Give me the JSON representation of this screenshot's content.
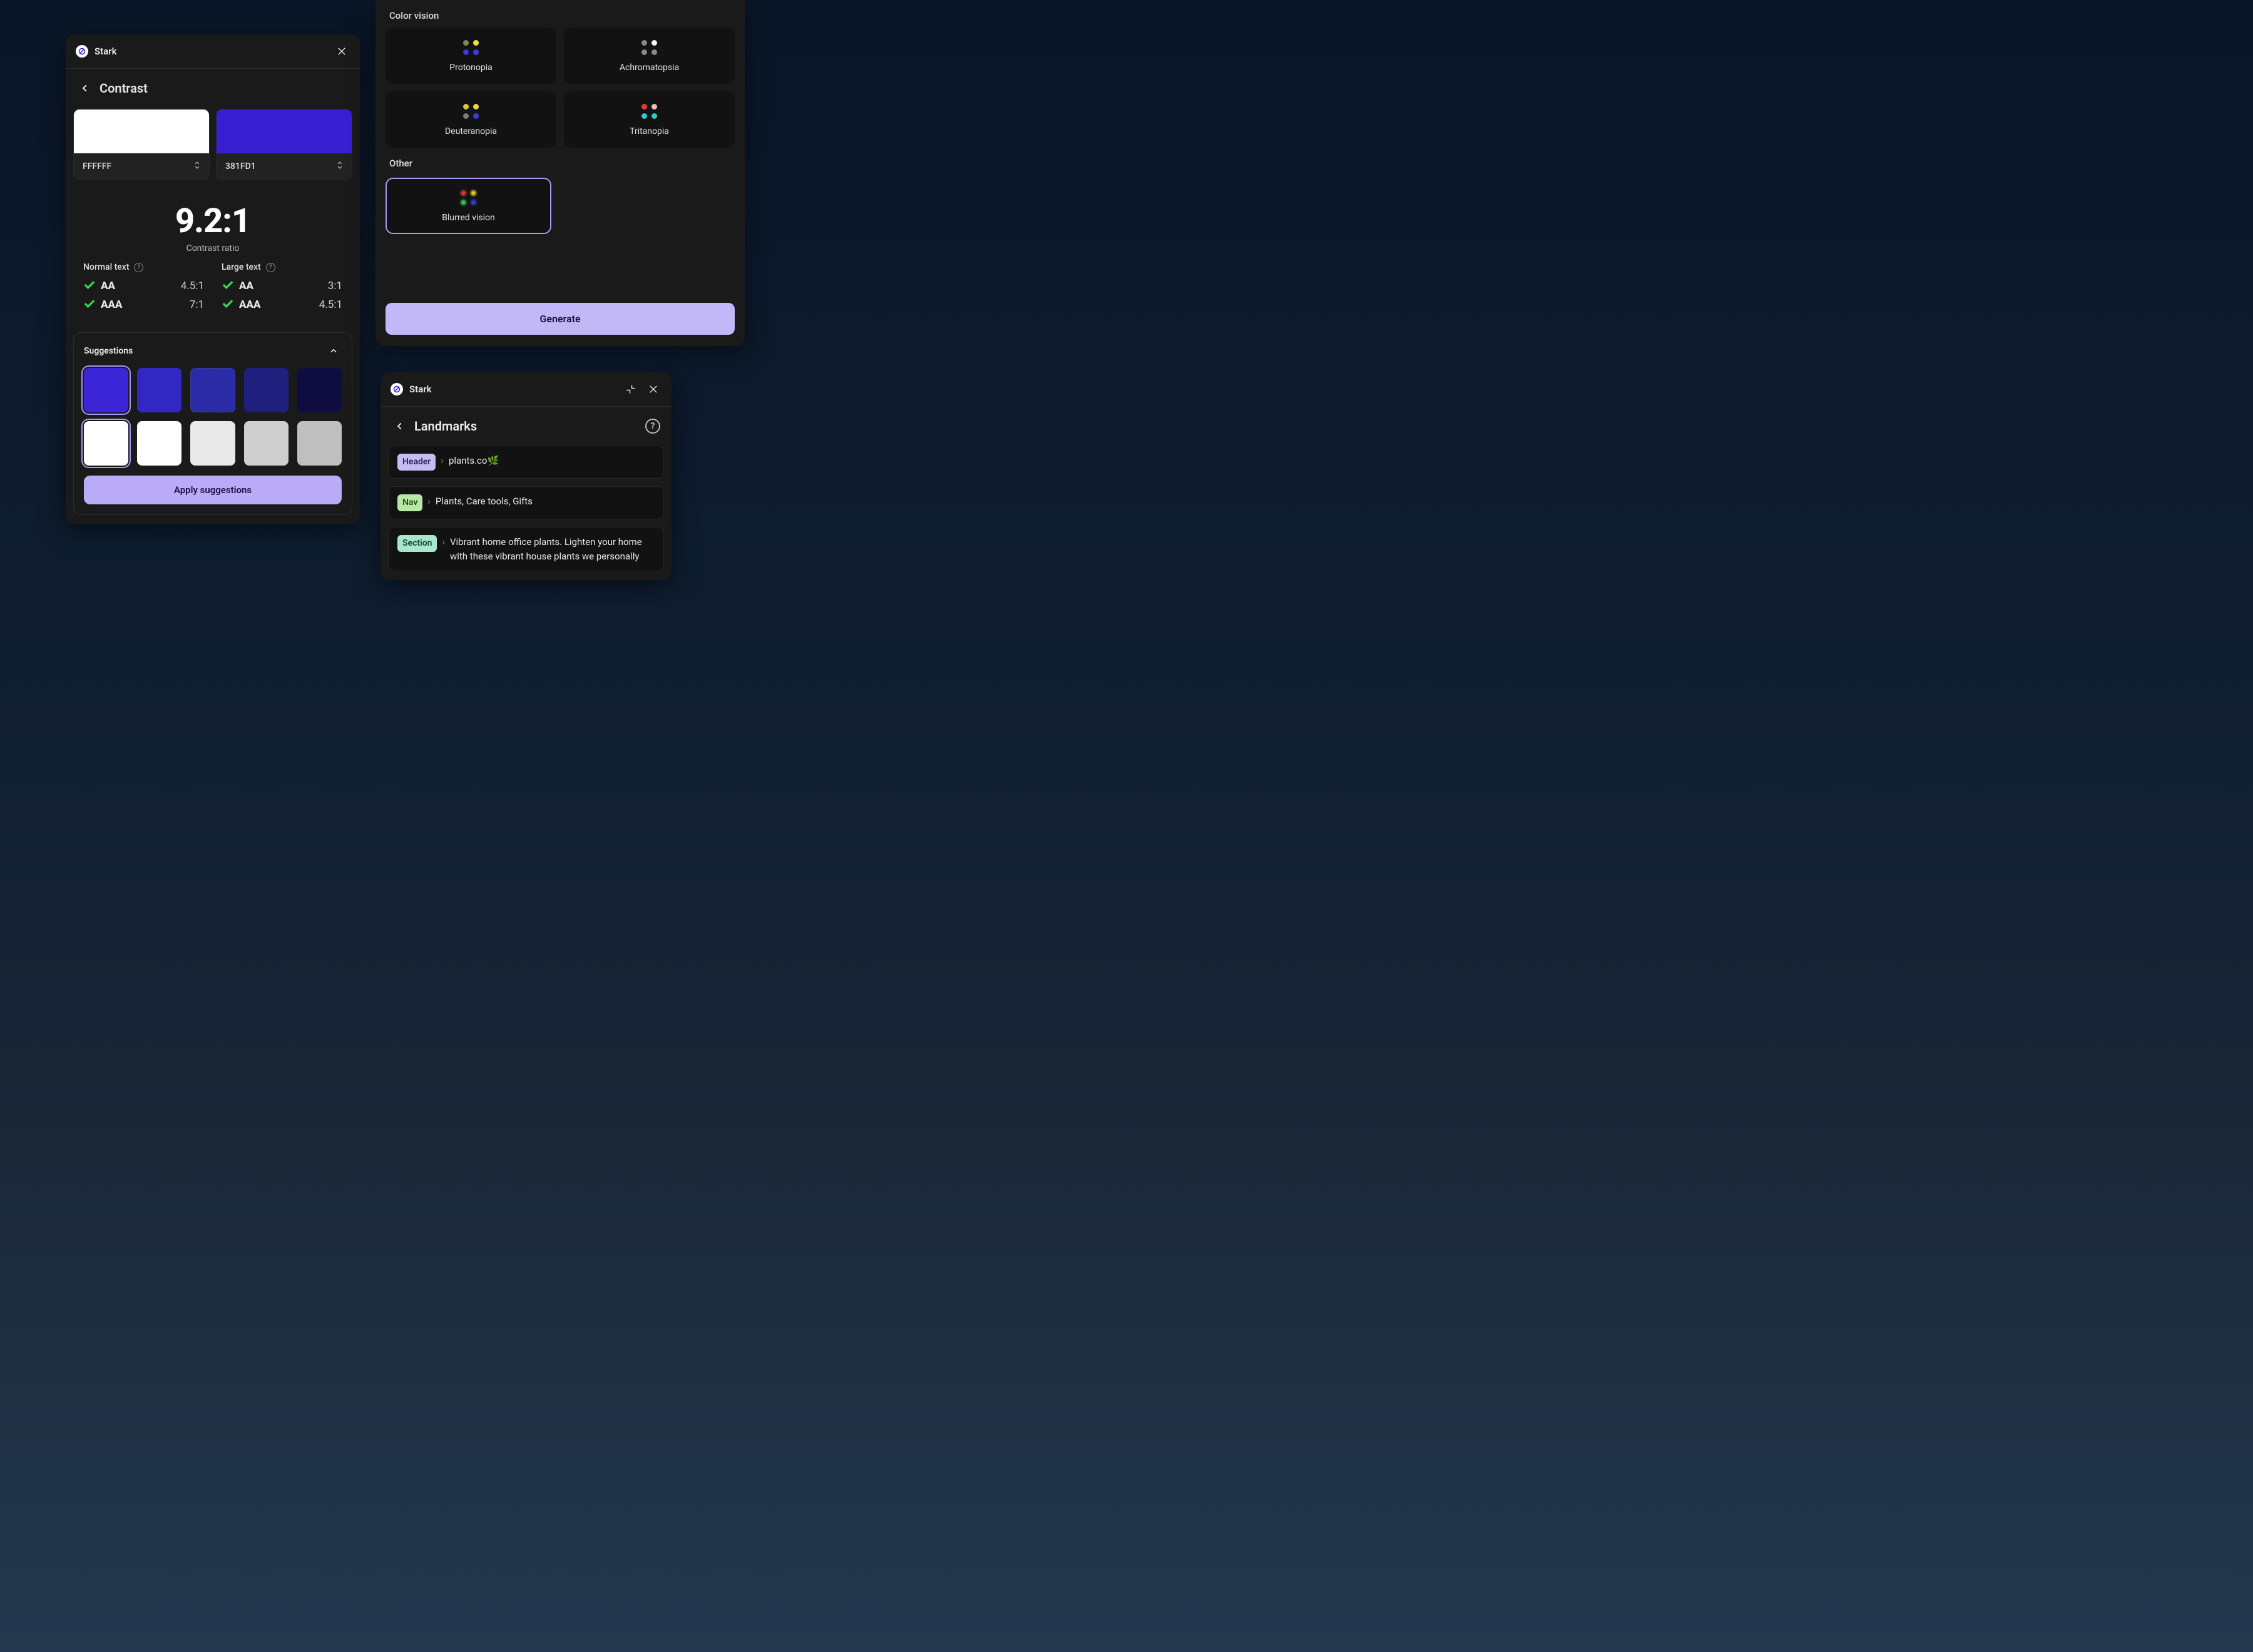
{
  "app_name": "Stark",
  "contrast": {
    "title": "Contrast",
    "fg_hex": "FFFFFF",
    "bg_hex": "381FD1",
    "fg_color": "#FFFFFF",
    "bg_color": "#381FD1",
    "ratio": "9.2:1",
    "ratio_label": "Contrast ratio",
    "normal_label": "Normal text",
    "large_label": "Large text",
    "normal_aa_level": "AA",
    "normal_aa_req": "4.5:1",
    "normal_aaa_level": "AAA",
    "normal_aaa_req": "7:1",
    "large_aa_level": "AA",
    "large_aa_req": "3:1",
    "large_aaa_level": "AAA",
    "large_aaa_req": "4.5:1",
    "suggestions_label": "Suggestions",
    "apply_label": "Apply suggestions",
    "sugg_row1": [
      "#3b25d6",
      "#3227c2",
      "#2c2ba7",
      "#1f1f7d",
      "#0f0c3f"
    ],
    "sugg_row2": [
      "#ffffff",
      "#ffffff",
      "#e9e9e9",
      "#cfcfcf",
      "#bfbfbf"
    ]
  },
  "vision": {
    "color_vision_label": "Color vision",
    "other_label": "Other",
    "generate_label": "Generate",
    "cards": {
      "protonopia": "Protonopia",
      "achromatopsia": "Achromatopsia",
      "deuteranopia": "Deuteranopia",
      "tritanopia": "Tritanopia",
      "blurred": "Blurred vision"
    },
    "dot_palettes": {
      "protonopia": [
        "#858555",
        "#f2e233",
        "#3b3be0",
        "#3b3be0"
      ],
      "achromatopsia": [
        "#8a8a8a",
        "#f2f2f2",
        "#8a8a8a",
        "#8a8a8a"
      ],
      "deuteranopia": [
        "#d8c933",
        "#e8d833",
        "#7a7a7a",
        "#3b3be0"
      ],
      "tritanopia": [
        "#e83a3a",
        "#f2bcbc",
        "#33c7c7",
        "#33c7c7"
      ],
      "blurred": [
        "#e83a3a",
        "#e8d134",
        "#3acb5a",
        "#3b3be0"
      ]
    }
  },
  "landmarks": {
    "title": "Landmarks",
    "items": [
      {
        "badge": "Header",
        "badge_class": "badge-header",
        "text": "plants.co🌿"
      },
      {
        "badge": "Nav",
        "badge_class": "badge-nav",
        "text": "Plants, Care tools, Gifts"
      },
      {
        "badge": "Section",
        "badge_class": "badge-section",
        "text": "Vibrant home office plants. Lighten your home with these vibrant house plants we personally"
      }
    ]
  }
}
